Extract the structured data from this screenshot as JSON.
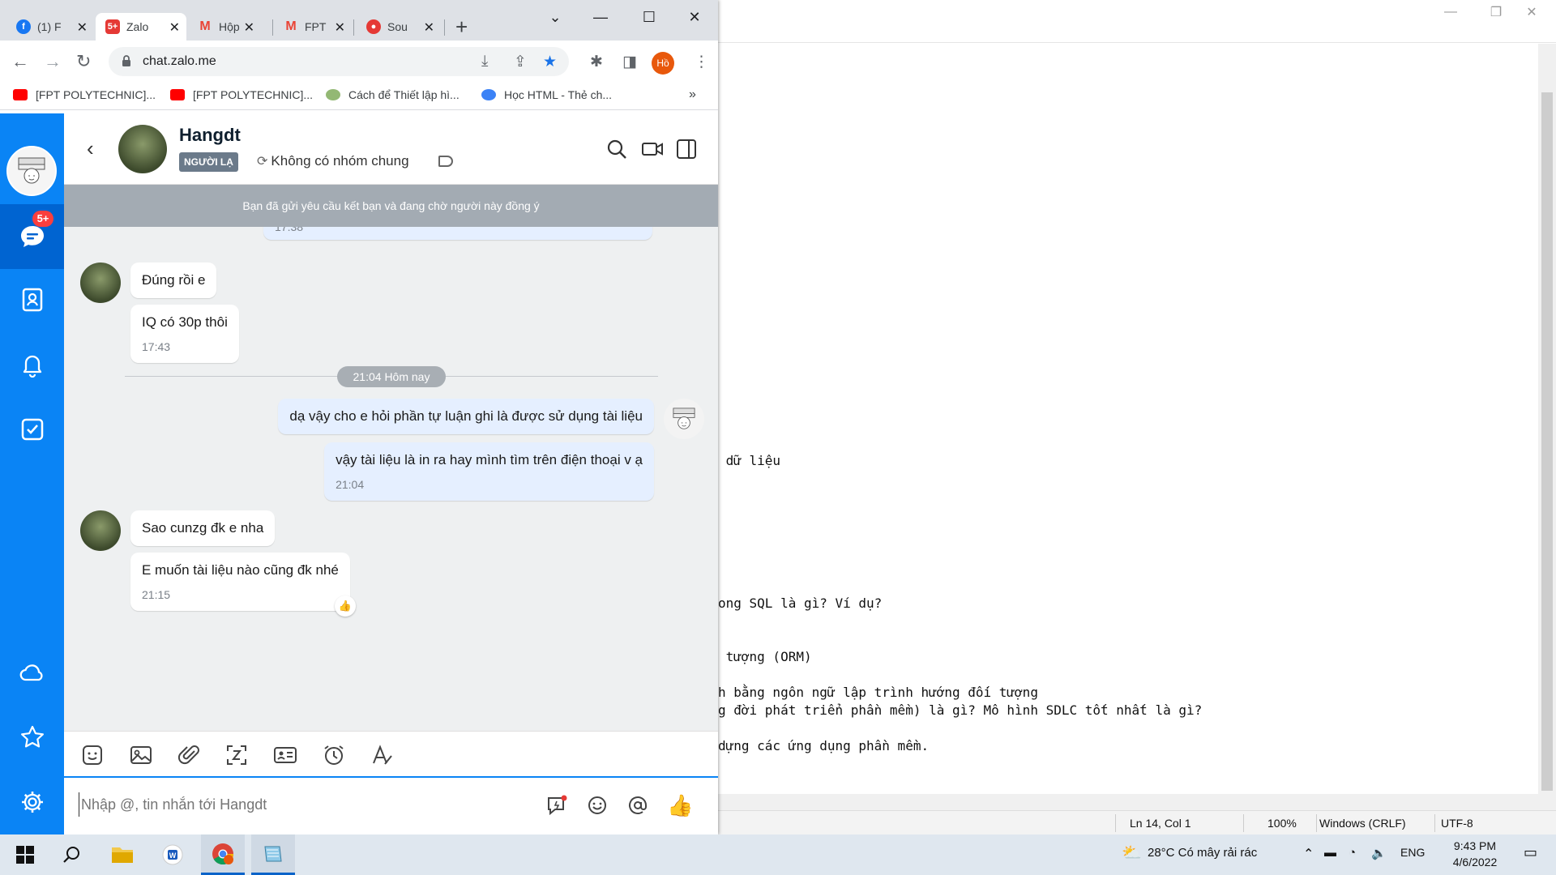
{
  "notepad": {
    "lines": [
      {
        "text": " dữ liệu",
        "row": 0
      },
      {
        "text": "ong SQL là gì? Ví dụ?",
        "row": 1
      },
      {
        "text": " tượng (ORM)",
        "row": 2
      },
      {
        "text": "h bằng ngôn ngữ lập trình hướng đối tượng",
        "row": 3
      },
      {
        "text": "g đời phát triển phần mềm) là gì? Mô hình SDLC tốt nhất là gì?",
        "row": 4
      },
      {
        "text": "dựng các ứng dụng phần mềm.",
        "row": 5
      }
    ],
    "status": {
      "position": "Ln 14, Col 1",
      "zoom": "100%",
      "line_ending": "Windows (CRLF)",
      "encoding": "UTF-8"
    }
  },
  "browser": {
    "tabs": [
      {
        "label": "(1) F",
        "icon": "facebook-icon",
        "color": "#1877f2"
      },
      {
        "label": "Zalo",
        "icon": "zalo-icon",
        "color": "#e53935",
        "active": true,
        "badge": "5+"
      },
      {
        "label": "Hộp",
        "icon": "gmail-icon",
        "color": "#ea4335"
      },
      {
        "label": "FPT",
        "icon": "gmail-icon",
        "color": "#ea4335"
      },
      {
        "label": "Sou",
        "icon": "sourcetree-icon",
        "color": "#e53935"
      }
    ],
    "url": "chat.zalo.me",
    "profile_initials": "Hồ",
    "bookmarks": [
      {
        "label": "[FPT POLYTECHNIC]...",
        "icon": "youtube-icon",
        "color": "#ff0000"
      },
      {
        "label": "[FPT POLYTECHNIC]...",
        "icon": "youtube-icon",
        "color": "#ff0000"
      },
      {
        "label": "Cách để Thiết lập hì...",
        "icon": "wikihow-icon",
        "color": "#93b874"
      },
      {
        "label": "Học HTML - Thẻ ch...",
        "icon": "site-icon",
        "color": "#3b82f6"
      }
    ],
    "bookmarks_more": "»"
  },
  "zalo": {
    "sidebar": {
      "badge": "5+",
      "accent": "#0a84f5"
    },
    "header": {
      "name": "Hangdt",
      "stranger_label": "NGƯỜI LẠ",
      "groups_text": "Không có nhóm chung"
    },
    "banner": "Bạn đã gửi yêu cầu kết bạn và đang chờ người này đồng ý",
    "messages": {
      "partial_time": "17:38",
      "m1": "Đúng rồi e",
      "m2": "IQ có 30p thôi",
      "m2_time": "17:43",
      "divider": "21:04 Hôm nay",
      "m3": "dạ vậy cho e hỏi phần tự luận ghi là được sử dụng tài liệu",
      "m4": "vậy tài liệu là in ra hay mình tìm trên điện thoại v ạ",
      "m4_time": "21:04",
      "m5": "Sao cunzg đk e nha",
      "m6": "E muốn tài liệu nào cũng đk nhé",
      "m6_time": "21:15"
    },
    "input_placeholder": "Nhập @, tin nhắn tới Hangdt"
  },
  "taskbar": {
    "weather": "28°C  Có mây rải rác",
    "language": "ENG",
    "time": "9:43 PM",
    "date": "4/6/2022"
  }
}
